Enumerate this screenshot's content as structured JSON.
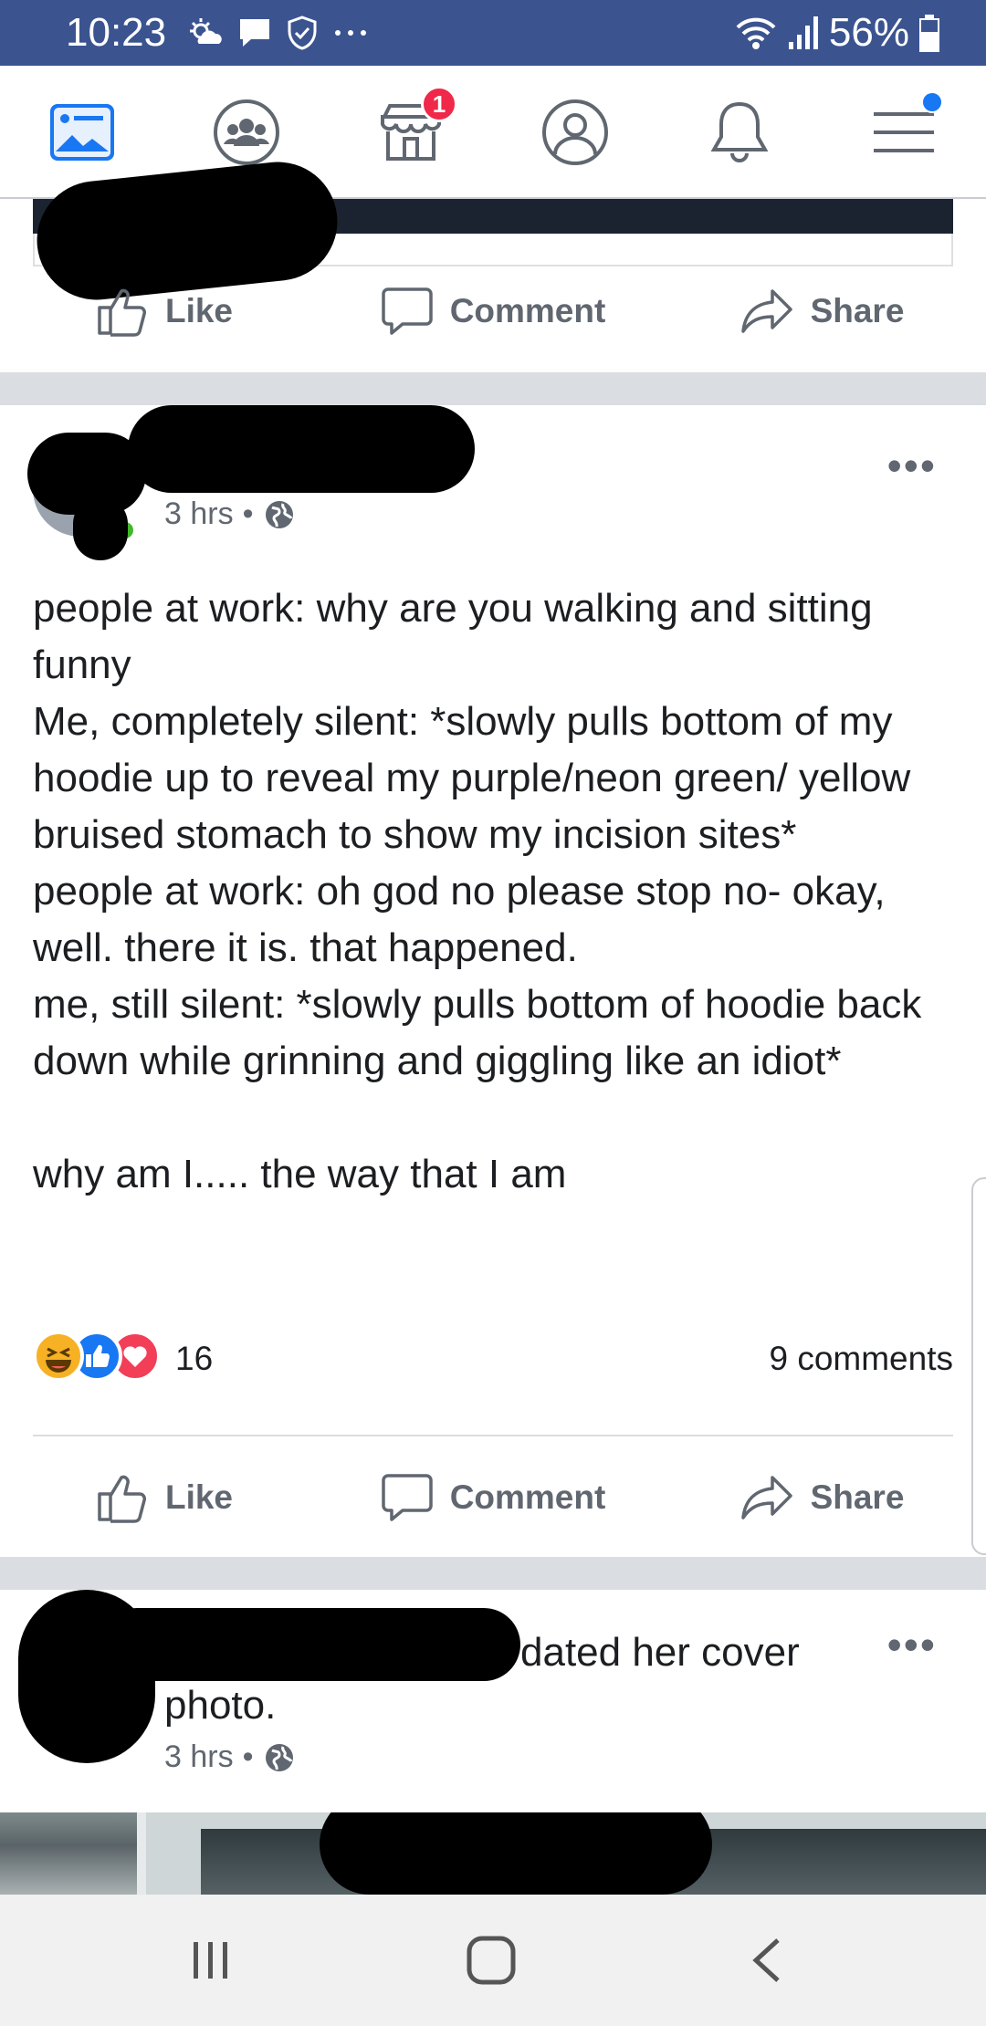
{
  "status_bar": {
    "time": "10:23",
    "battery": "56%",
    "left_icons": [
      "weather-icon",
      "message-icon",
      "shield-icon",
      "more-dots-icon"
    ],
    "right_icons": [
      "wifi-icon",
      "signal-icon",
      "battery-icon"
    ]
  },
  "nav": {
    "items": [
      "news-feed-icon",
      "groups-icon",
      "marketplace-icon",
      "profile-icon",
      "notifications-icon",
      "menu-icon"
    ],
    "marketplace_badge": "1"
  },
  "actions": {
    "like": "Like",
    "comment": "Comment",
    "share": "Share"
  },
  "post": {
    "time": "3 hrs",
    "more": "•••",
    "text": "people at work: why are you walking and sitting funny\nMe, completely silent: *slowly pulls bottom of my hoodie up to reveal my purple/neon green/ yellow bruised stomach to show my incision sites*\npeople at work: oh god no please stop no- okay, well. there it is. that happened.\nme, still silent: *slowly pulls bottom of hoodie back down while grinning and giggling like an idiot*\n\nwhy am I..... the way that I am",
    "reaction_count": "16",
    "comment_count": "9 comments",
    "reactions": [
      "haha-reaction-icon",
      "like-reaction-icon",
      "love-reaction-icon"
    ]
  },
  "next_post": {
    "title": "dated her cover photo.",
    "time": "3 hrs",
    "more": "•••"
  },
  "colors": {
    "status_bar": "#3b5490",
    "fb_blue": "#1877f2",
    "badge_red": "#f02849",
    "online_green": "#42b72a",
    "gray_text": "#606770"
  }
}
